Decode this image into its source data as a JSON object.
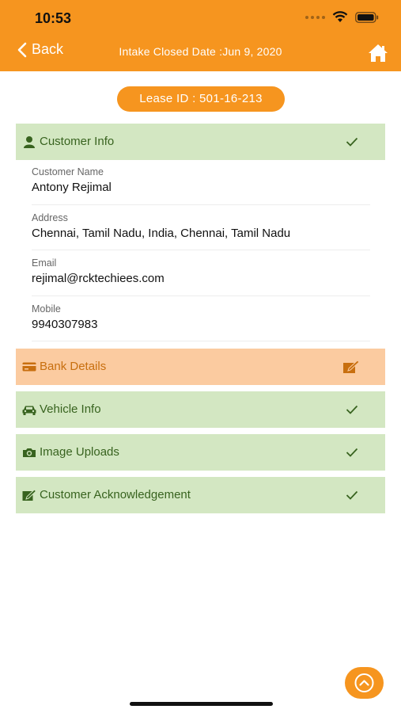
{
  "status_bar": {
    "time": "10:53"
  },
  "nav": {
    "back_label": "Back",
    "title": "Intake Closed Date :Jun 9, 2020",
    "home_icon": "home-icon"
  },
  "lease": {
    "label": "Lease ID : 501-16-213"
  },
  "sections": {
    "customer_info": {
      "label": "Customer Info",
      "state": "complete"
    },
    "bank_details": {
      "label": "Bank Details",
      "state": "edit"
    },
    "vehicle_info": {
      "label": "Vehicle Info",
      "state": "complete"
    },
    "image_uploads": {
      "label": "Image Uploads",
      "state": "complete"
    },
    "acknowledgement": {
      "label": "Customer Acknowledgement",
      "state": "complete"
    }
  },
  "customer": {
    "name_label": "Customer Name",
    "name": "Antony Rejimal",
    "address_label": "Address",
    "address": "Chennai, Tamil Nadu, India, Chennai, Tamil Nadu",
    "email_label": "Email",
    "email": "rejimal@rcktechiees.com",
    "mobile_label": "Mobile",
    "mobile": "9940307983"
  },
  "colors": {
    "accent": "#f6951f",
    "complete_bg": "#d3e7c2",
    "complete_text": "#38631f",
    "pending_bg": "#fbcba0",
    "pending_text": "#c86f0f"
  }
}
